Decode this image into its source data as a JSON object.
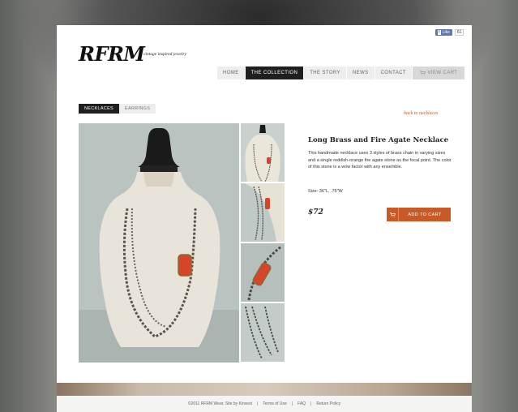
{
  "header": {
    "logo": "RFRM",
    "tagline": "vintage inspired jewelry",
    "facebook": {
      "like_label": "Like",
      "count": "61"
    }
  },
  "nav": {
    "items": [
      {
        "label": "HOME"
      },
      {
        "label": "THE COLLECTION"
      },
      {
        "label": "THE STORY"
      },
      {
        "label": "NEWS"
      },
      {
        "label": "CONTACT"
      }
    ],
    "cart_label": "VIEW CART"
  },
  "subtabs": [
    {
      "label": "NECKLACES"
    },
    {
      "label": "EARRINGS"
    }
  ],
  "back_link": "back to necklaces",
  "product": {
    "title": "Long Brass and Fire Agate Necklace",
    "description": "This handmade necklace uses 3 styles of brass chain in varying sizes and a single reddish-orange fire agate stone as the focal point. The color of this stone is a wow factor with any ensemble.",
    "size": "Size: 36\"L, .75\"W",
    "price": "$72",
    "add_to_cart_label": "ADD TO CART"
  },
  "footer": {
    "copyright": "©2011 RFRM Wear. Site by Kinvest",
    "links": [
      {
        "label": "Terms of Use"
      },
      {
        "label": "FAQ"
      },
      {
        "label": "Return Policy"
      }
    ]
  },
  "colors": {
    "accent": "#c85a28",
    "nav_active": "#1f1f1f",
    "fb_blue": "#5f78ab"
  },
  "icons": {
    "cart": "cart-icon",
    "facebook": "facebook-icon"
  }
}
